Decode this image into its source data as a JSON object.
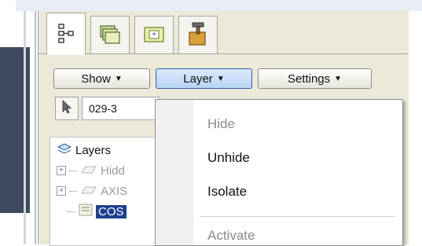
{
  "tabs": [
    {
      "icon": "hierarchy-icon"
    },
    {
      "icon": "folders-icon"
    },
    {
      "icon": "star-folder-icon"
    },
    {
      "icon": "toolbox-icon"
    }
  ],
  "toolbar": {
    "show_label": "Show",
    "layer_label": "Layer",
    "settings_label": "Settings"
  },
  "level_combo": {
    "value": "029-3"
  },
  "tree": {
    "root_label": "Layers",
    "items": [
      {
        "label": "Hidd",
        "state": "dim"
      },
      {
        "label": "AXIS",
        "state": "dim"
      },
      {
        "label": "COS",
        "state": "selected"
      }
    ]
  },
  "layer_menu": {
    "items": [
      {
        "label": "Hide",
        "enabled": false
      },
      {
        "label": "Unhide",
        "enabled": true
      },
      {
        "label": "Isolate",
        "enabled": true
      },
      {
        "label": "Activate",
        "enabled": false
      }
    ]
  },
  "colors": {
    "accent": "#2f5fa8",
    "selection": "#1f3f8f",
    "panel": "#ece9d8"
  }
}
